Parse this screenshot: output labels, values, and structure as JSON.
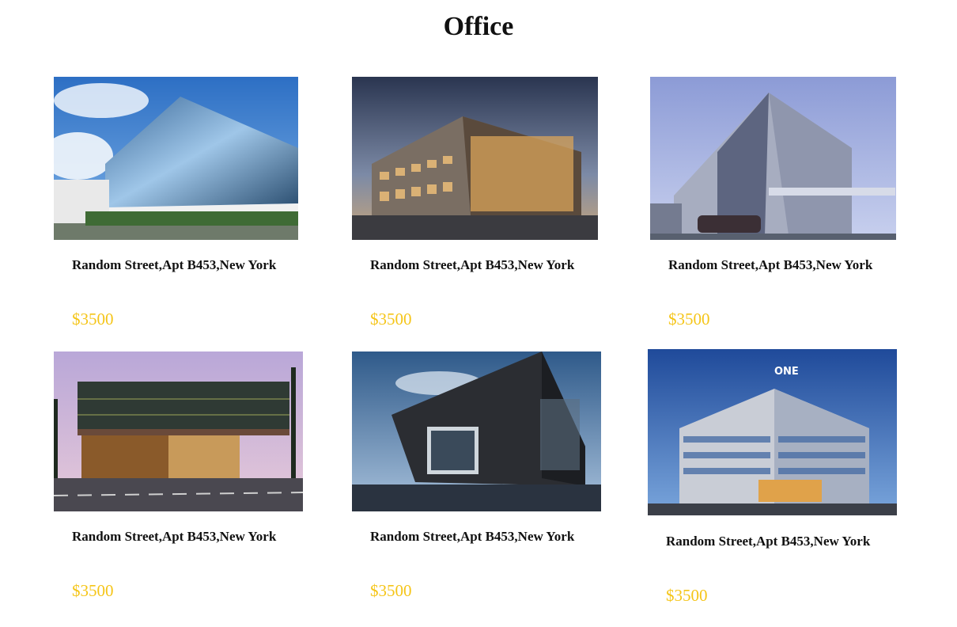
{
  "page": {
    "title": "Office"
  },
  "listings": [
    {
      "address": "Random Street,Apt B453,New York",
      "price": "$3500",
      "image": "office-building-photo"
    },
    {
      "address": "Random Street,Apt B453,New York",
      "price": "$3500",
      "image": "office-building-photo"
    },
    {
      "address": "Random Street,Apt B453,New York",
      "price": "$3500",
      "image": "office-building-photo"
    },
    {
      "address": "Random Street,Apt B453,New York",
      "price": "$3500",
      "image": "office-building-photo"
    },
    {
      "address": "Random Street,Apt B453,New York",
      "price": "$3500",
      "image": "office-building-photo"
    },
    {
      "address": "Random Street,Apt B453,New York",
      "price": "$3500",
      "image": "office-building-photo"
    }
  ],
  "colors": {
    "price": "#f5c518",
    "title": "#111111",
    "background": "#ffffff"
  }
}
